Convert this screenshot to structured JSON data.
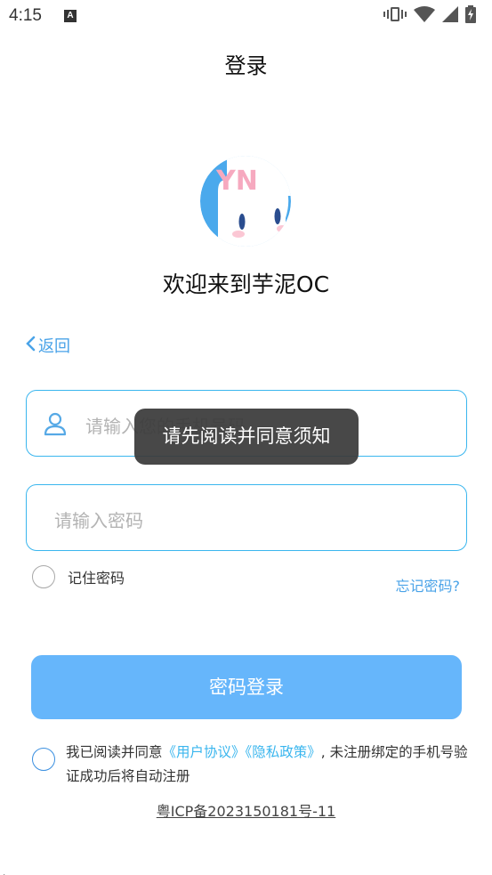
{
  "status_bar": {
    "time": "4:15",
    "notification_badge": "A",
    "icons": [
      "vibrate-icon",
      "wifi-icon",
      "signal-icon",
      "battery-charging-icon"
    ]
  },
  "nav": {
    "title": "登录"
  },
  "logo": {
    "letters": "YN",
    "icon": "cat-mascot-logo"
  },
  "welcome": "欢迎来到芋泥OC",
  "back": {
    "label": "返回",
    "icon": "chevron-left-icon"
  },
  "phone_input": {
    "placeholder": "请输入您的手机号码",
    "value": "",
    "icon": "user-icon"
  },
  "password_input": {
    "placeholder": "请输入密码",
    "value": ""
  },
  "remember": {
    "label": "记住密码",
    "checked": false
  },
  "forgot": "忘记密码?",
  "login_button": "密码登录",
  "agreement": {
    "checked": false,
    "prefix": "我已阅读并同意",
    "user_agreement": "《用户协议》",
    "privacy_policy": "《隐私政策》",
    "suffix": ", 未注册绑定的手机号验证成功后将自动注册"
  },
  "icp": "粤ICP备2023150181号-11",
  "toast": "请先阅读并同意须知",
  "colors": {
    "accent": "#3ab6ee",
    "link": "#4aa3e8",
    "button": "#66b6fb",
    "toast_bg": "#3a3a3a"
  }
}
